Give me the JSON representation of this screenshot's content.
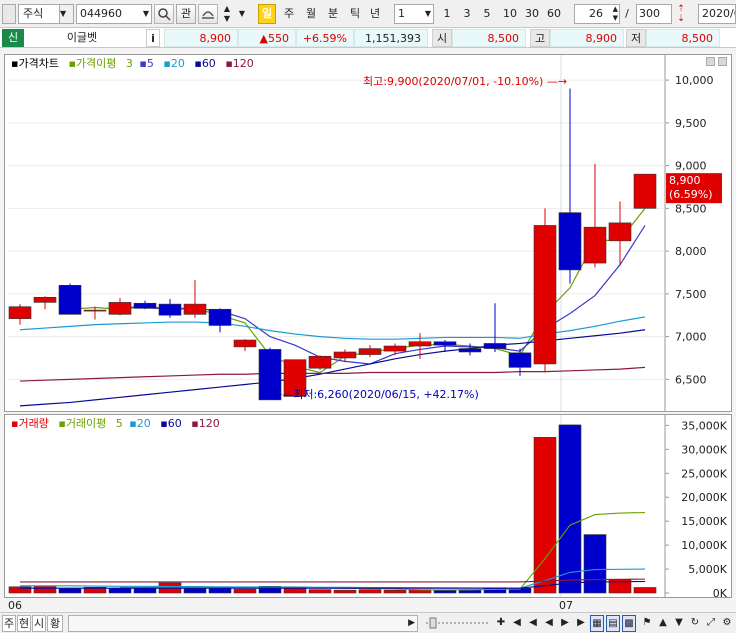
{
  "toolbar": {
    "market_type": "주식",
    "stock_code": "044960",
    "btn_gwan": "관",
    "btn_il": "일",
    "btn_ju": "주",
    "btn_wol": "월",
    "btn_bun": "분",
    "btn_tik": "틱",
    "btn_nyeon": "년",
    "interval_value": "1",
    "periods": [
      "1",
      "3",
      "5",
      "10",
      "30",
      "60"
    ],
    "count_value": "26",
    "separator": "/",
    "total_value": "300",
    "date_value": "2020/0"
  },
  "infobar": {
    "status_badge": "신",
    "stock_name": "이글벳",
    "info_icon": "i",
    "price": "8,900",
    "change": "▲550",
    "change_pct": "+6.59%",
    "volume": "1,151,393",
    "open_label": "시",
    "open_value": "8,500",
    "high_label": "고",
    "high_value": "8,900",
    "low_label": "저",
    "low_value": "8,500"
  },
  "price_legend": {
    "title": "가격차트",
    "ma_label": "가격이평",
    "ma3": "3",
    "ma5": "5",
    "ma20": "20",
    "ma60": "60",
    "ma120": "120"
  },
  "volume_legend": {
    "title": "거래량",
    "ma_label": "거래이평",
    "ma5": "5",
    "ma20": "20",
    "ma60": "60",
    "ma120": "120"
  },
  "annotations": {
    "high": "최고:9,900(2020/07/01, -10.10%)",
    "low": "최저:6,260(2020/06/15, +42.17%)",
    "current_price": "8,900",
    "current_pct": "(6.59%)"
  },
  "x_labels": [
    "06",
    "07"
  ],
  "bottom_tabs": [
    "주",
    "현",
    "시",
    "황"
  ],
  "colors": {
    "up": "#e00000",
    "down": "#0000cc",
    "ma3": "#6aa000",
    "ma5": "#3a3acc",
    "ma20": "#1a9ad0",
    "ma60": "#0a0a9a",
    "ma120": "#8a1a3a"
  },
  "chart_data": [
    {
      "type": "candlestick",
      "title": "가격차트",
      "ylim": [
        6200,
        10200
      ],
      "y_ticks": [
        "6,500",
        "7,000",
        "7,500",
        "8,000",
        "8,500",
        "9,000",
        "9,500",
        "10,000"
      ],
      "y_tick_values": [
        6500,
        7000,
        7500,
        8000,
        8500,
        9000,
        9500,
        10000
      ],
      "candles": [
        {
          "o": 7210,
          "h": 7380,
          "l": 7140,
          "c": 7350
        },
        {
          "o": 7400,
          "h": 7470,
          "l": 7320,
          "c": 7460
        },
        {
          "o": 7600,
          "h": 7620,
          "l": 7260,
          "c": 7260
        },
        {
          "o": 7300,
          "h": 7350,
          "l": 7200,
          "c": 7310
        },
        {
          "o": 7260,
          "h": 7450,
          "l": 7250,
          "c": 7400
        },
        {
          "o": 7390,
          "h": 7420,
          "l": 7320,
          "c": 7330
        },
        {
          "o": 7380,
          "h": 7440,
          "l": 7220,
          "c": 7250
        },
        {
          "o": 7260,
          "h": 7660,
          "l": 7220,
          "c": 7380
        },
        {
          "o": 7320,
          "h": 7330,
          "l": 7050,
          "c": 7130
        },
        {
          "o": 6880,
          "h": 6970,
          "l": 6830,
          "c": 6960
        },
        {
          "o": 6850,
          "h": 6870,
          "l": 6260,
          "c": 6260
        },
        {
          "o": 6300,
          "h": 6730,
          "l": 6290,
          "c": 6730
        },
        {
          "o": 6630,
          "h": 6780,
          "l": 6610,
          "c": 6770
        },
        {
          "o": 6750,
          "h": 6850,
          "l": 6700,
          "c": 6820
        },
        {
          "o": 6790,
          "h": 6900,
          "l": 6760,
          "c": 6860
        },
        {
          "o": 6830,
          "h": 6920,
          "l": 6780,
          "c": 6890
        },
        {
          "o": 6890,
          "h": 7040,
          "l": 6740,
          "c": 6940
        },
        {
          "o": 6940,
          "h": 6960,
          "l": 6820,
          "c": 6900
        },
        {
          "o": 6860,
          "h": 6920,
          "l": 6780,
          "c": 6820
        },
        {
          "o": 6920,
          "h": 7390,
          "l": 6820,
          "c": 6860
        },
        {
          "o": 6810,
          "h": 6860,
          "l": 6540,
          "c": 6640
        },
        {
          "o": 6680,
          "h": 8500,
          "l": 6580,
          "c": 8300
        },
        {
          "o": 8450,
          "h": 9900,
          "l": 7620,
          "c": 7780
        },
        {
          "o": 7860,
          "h": 9020,
          "l": 7810,
          "c": 8280
        },
        {
          "o": 8120,
          "h": 8580,
          "l": 7830,
          "c": 8330
        },
        {
          "o": 8500,
          "h": 8900,
          "l": 8500,
          "c": 8900
        }
      ],
      "series": [
        {
          "name": "3",
          "color_key": "ma3",
          "values": [
            null,
            null,
            7320,
            7340,
            7320,
            7350,
            7330,
            7330,
            7250,
            7160,
            6780,
            6650,
            6580,
            6770,
            6820,
            6860,
            6900,
            6910,
            6890,
            6860,
            6780,
            7270,
            7570,
            8120,
            8130,
            8500
          ]
        },
        {
          "name": "5",
          "color_key": "ma5",
          "values": [
            null,
            null,
            null,
            null,
            7350,
            7340,
            7320,
            7330,
            7300,
            7210,
            7000,
            6900,
            6760,
            6710,
            6680,
            6800,
            6850,
            6890,
            6880,
            6870,
            6830,
            7090,
            7270,
            7480,
            7840,
            8300
          ]
        },
        {
          "name": "20",
          "color_key": "ma20",
          "values": [
            7080,
            7100,
            7120,
            7140,
            7150,
            7160,
            7170,
            7170,
            7160,
            7120,
            7070,
            7030,
            7000,
            6980,
            6970,
            6970,
            6980,
            6990,
            6990,
            6990,
            6980,
            7030,
            7070,
            7120,
            7180,
            7230
          ]
        },
        {
          "name": "60",
          "color_key": "ma60",
          "values": [
            6190,
            6210,
            6230,
            6260,
            6290,
            6320,
            6350,
            6380,
            6410,
            6440,
            6470,
            6510,
            6560,
            6620,
            6680,
            6740,
            6790,
            6830,
            6860,
            6900,
            6920,
            6950,
            6980,
            7010,
            7040,
            7080
          ]
        },
        {
          "name": "120",
          "color_key": "ma120",
          "values": [
            6480,
            6490,
            6500,
            6510,
            6520,
            6530,
            6540,
            6550,
            6560,
            6560,
            6570,
            6570,
            6570,
            6570,
            6580,
            6580,
            6580,
            6580,
            6580,
            6580,
            6590,
            6590,
            6600,
            6610,
            6620,
            6640
          ]
        }
      ]
    },
    {
      "type": "bar",
      "title": "거래량",
      "ylim": [
        0,
        35500
      ],
      "y_ticks": [
        "0K",
        "5,000K",
        "10,000K",
        "15,000K",
        "20,000K",
        "25,000K",
        "30,000K",
        "35,000K"
      ],
      "y_tick_values": [
        0,
        5000,
        10000,
        15000,
        20000,
        25000,
        30000,
        35000
      ],
      "values": [
        1300,
        1500,
        900,
        1200,
        1000,
        1100,
        2100,
        900,
        1000,
        800,
        1400,
        1300,
        700,
        600,
        700,
        600,
        700,
        600,
        700,
        1100,
        1000,
        32500,
        35100,
        12200,
        2800,
        1150
      ],
      "directions": [
        "up",
        "up",
        "down",
        "up",
        "down",
        "down",
        "up",
        "down",
        "down",
        "up",
        "down",
        "up",
        "up",
        "up",
        "up",
        "up",
        "up",
        "down",
        "down",
        "down",
        "down",
        "up",
        "down",
        "down",
        "up",
        "up"
      ],
      "series": [
        {
          "name": "5",
          "color_key": "ma3",
          "values": [
            null,
            null,
            null,
            null,
            1180,
            1140,
            1260,
            1240,
            1220,
            1180,
            1240,
            1280,
            1120,
            960,
            940,
            860,
            660,
            640,
            660,
            740,
            820,
            7180,
            14160,
            16380,
            16700,
            16800
          ]
        },
        {
          "name": "20",
          "color_key": "ma20",
          "values": [
            1500,
            1500,
            1500,
            1450,
            1400,
            1400,
            1380,
            1350,
            1300,
            1280,
            1250,
            1230,
            1200,
            1180,
            1150,
            1130,
            1100,
            1080,
            1050,
            1030,
            1000,
            2600,
            4300,
            4900,
            4950,
            5000
          ]
        },
        {
          "name": "60",
          "color_key": "ma60",
          "values": [
            1000,
            1000,
            1000,
            1000,
            1000,
            1000,
            1000,
            1000,
            1000,
            1000,
            1000,
            1000,
            1000,
            1000,
            1000,
            1000,
            1000,
            1000,
            1000,
            1000,
            1000,
            1520,
            2100,
            2300,
            2350,
            2400
          ]
        },
        {
          "name": "120",
          "color_key": "ma120",
          "values": [
            2300,
            2300,
            2300,
            2300,
            2300,
            2300,
            2300,
            2300,
            2300,
            2300,
            2300,
            2300,
            2300,
            2300,
            2300,
            2300,
            2300,
            2300,
            2300,
            2300,
            2300,
            2500,
            2700,
            2800,
            2850,
            2900
          ]
        }
      ]
    }
  ]
}
